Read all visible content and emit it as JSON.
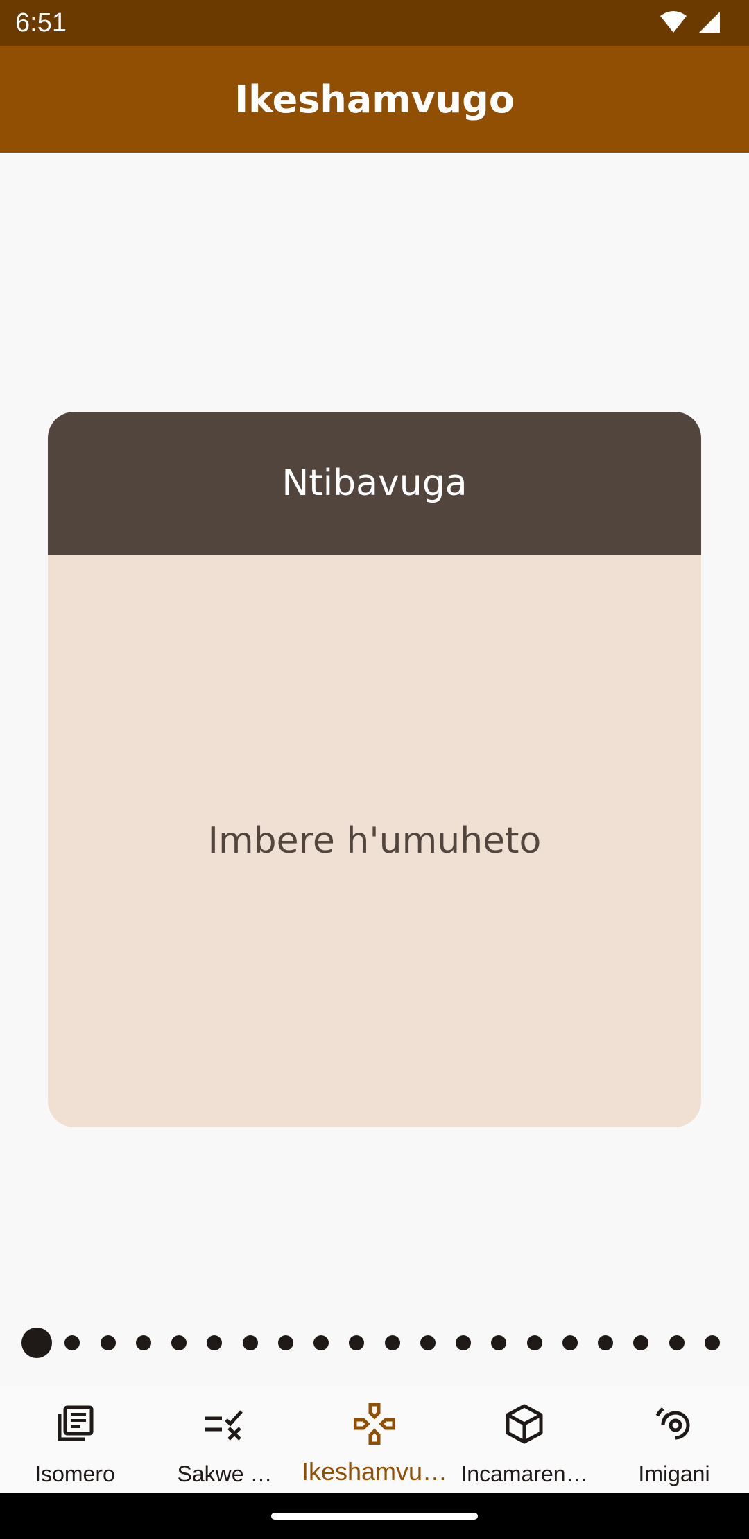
{
  "status_bar": {
    "time": "6:51"
  },
  "app_bar": {
    "title": "Ikeshamvugo"
  },
  "card": {
    "header": "Ntibavuga",
    "body": "Imbere h'umuheto"
  },
  "pager": {
    "total": 20,
    "current_index": 0
  },
  "bottom_nav": {
    "items": [
      {
        "label": "Isomero",
        "icon": "library-books-icon",
        "active": false
      },
      {
        "label": "Sakwe …",
        "icon": "checklist-icon",
        "active": false
      },
      {
        "label": "Ikeshamvu…",
        "icon": "game-controller-icon",
        "active": true
      },
      {
        "label": "Incamaren…",
        "icon": "cube-icon",
        "active": false
      },
      {
        "label": "Imigani",
        "icon": "spiral-icon",
        "active": false
      }
    ]
  },
  "colors": {
    "status_bar": "#6b3a00",
    "app_bar": "#904f03",
    "card_header": "#51453e",
    "card_body": "#f0dfd3",
    "active_nav": "#904f03",
    "text_dark": "#1f1a18"
  }
}
